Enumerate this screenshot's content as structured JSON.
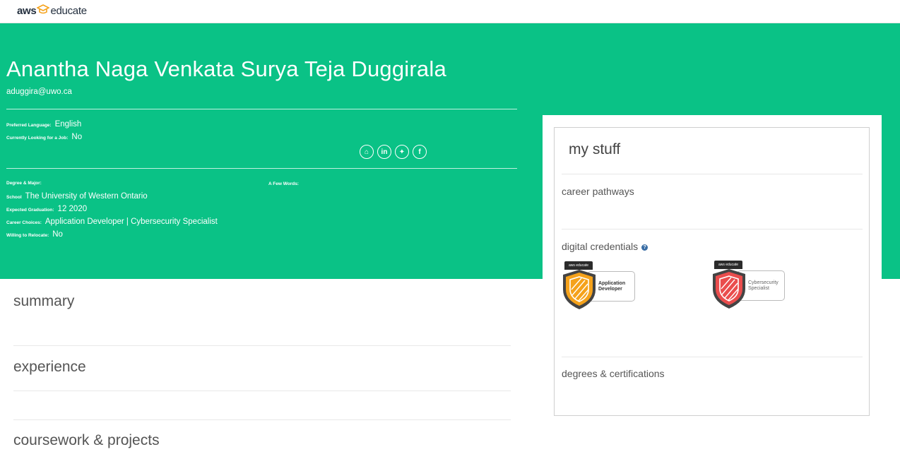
{
  "brand": {
    "aws": "aws",
    "educate": "educate"
  },
  "profile": {
    "name": "Anantha Naga Venkata Surya Teja Duggirala",
    "email": "aduggira@uwo.ca",
    "preferred_language": {
      "label": "Preferred Language:",
      "value": "English"
    },
    "looking_for_job": {
      "label": "Currently Looking for a Job:",
      "value": "No"
    },
    "degree_major": {
      "label": "Degree & Major:"
    },
    "school": {
      "label": "School",
      "value": "The University of Western Ontario"
    },
    "expected_graduation": {
      "label": "Expected Graduation:",
      "value": "12 2020"
    },
    "career_choices": {
      "label": "Career Choices:",
      "value": "Application Developer | Cybersecurity Specialist"
    },
    "willing_to_relocate": {
      "label": "Willing to Relocate:",
      "value": "No"
    },
    "few_words": {
      "label": "A Few Words:"
    }
  },
  "socials": [
    {
      "icon": "github-icon",
      "glyph": "⌂"
    },
    {
      "icon": "linkedin-icon",
      "glyph": "in"
    },
    {
      "icon": "twitter-icon",
      "glyph": "✦"
    },
    {
      "icon": "facebook-icon",
      "glyph": "f"
    }
  ],
  "my_stuff": {
    "title": "my stuff",
    "career_pathways": "career pathways",
    "digital_credentials": "digital credentials",
    "help_glyph": "?",
    "degrees_certifications": "degrees & certifications",
    "badges": [
      {
        "tag": "aws educate",
        "line1": "Application",
        "line2": "Developer",
        "color": "#f5a21b"
      },
      {
        "tag": "aws educate",
        "line1": "Cybersecurity",
        "line2": "Specialist",
        "color": "#ea4d4d"
      }
    ]
  },
  "sections": {
    "summary": "summary",
    "experience": "experience",
    "coursework": "coursework & projects"
  },
  "colors": {
    "hero_green": "#0ac286",
    "brand_orange": "#f5a21b",
    "badge_red": "#ea4d4d"
  }
}
